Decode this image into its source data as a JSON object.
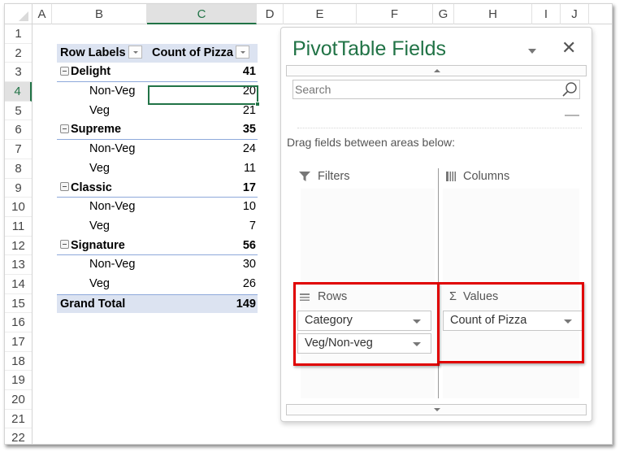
{
  "spreadsheet": {
    "columns": [
      "A",
      "B",
      "C",
      "D",
      "E",
      "F",
      "G",
      "H",
      "I",
      "J"
    ],
    "active_column": "C",
    "rows": [
      "1",
      "2",
      "3",
      "4",
      "5",
      "6",
      "7",
      "8",
      "9",
      "10",
      "11",
      "12",
      "13",
      "14",
      "15",
      "16",
      "17",
      "18",
      "19",
      "20",
      "21",
      "22"
    ],
    "active_row": "4",
    "selected_cell": "C4"
  },
  "pivot_table": {
    "header": {
      "row_labels": "Row Labels",
      "values": "Count of Pizza"
    },
    "groups": [
      {
        "label": "Delight",
        "total": "41",
        "children": [
          {
            "label": "Non-Veg",
            "value": "20"
          },
          {
            "label": "Veg",
            "value": "21"
          }
        ]
      },
      {
        "label": "Supreme",
        "total": "35",
        "children": [
          {
            "label": "Non-Veg",
            "value": "24"
          },
          {
            "label": "Veg",
            "value": "11"
          }
        ]
      },
      {
        "label": "Classic",
        "total": "17",
        "children": [
          {
            "label": "Non-Veg",
            "value": "10"
          },
          {
            "label": "Veg",
            "value": "7"
          }
        ]
      },
      {
        "label": "Signature",
        "total": "56",
        "children": [
          {
            "label": "Non-Veg",
            "value": "30"
          },
          {
            "label": "Veg",
            "value": "26"
          }
        ]
      }
    ],
    "grand_total": {
      "label": "Grand Total",
      "value": "149"
    }
  },
  "pane": {
    "title": "PivotTable Fields",
    "close_glyph": "✕",
    "search_placeholder": "Search",
    "drag_label": "Drag fields between areas below:",
    "areas": {
      "filters": {
        "title": "Filters",
        "fields": []
      },
      "columns": {
        "title": "Columns",
        "fields": []
      },
      "rows": {
        "title": "Rows",
        "fields": [
          "Category",
          "Veg/Non-veg"
        ]
      },
      "values": {
        "title": "Values",
        "icon_glyph": "Σ",
        "fields": [
          "Count of Pizza"
        ]
      }
    },
    "highlight_color": "#e00000",
    "accent_color": "#217346"
  }
}
